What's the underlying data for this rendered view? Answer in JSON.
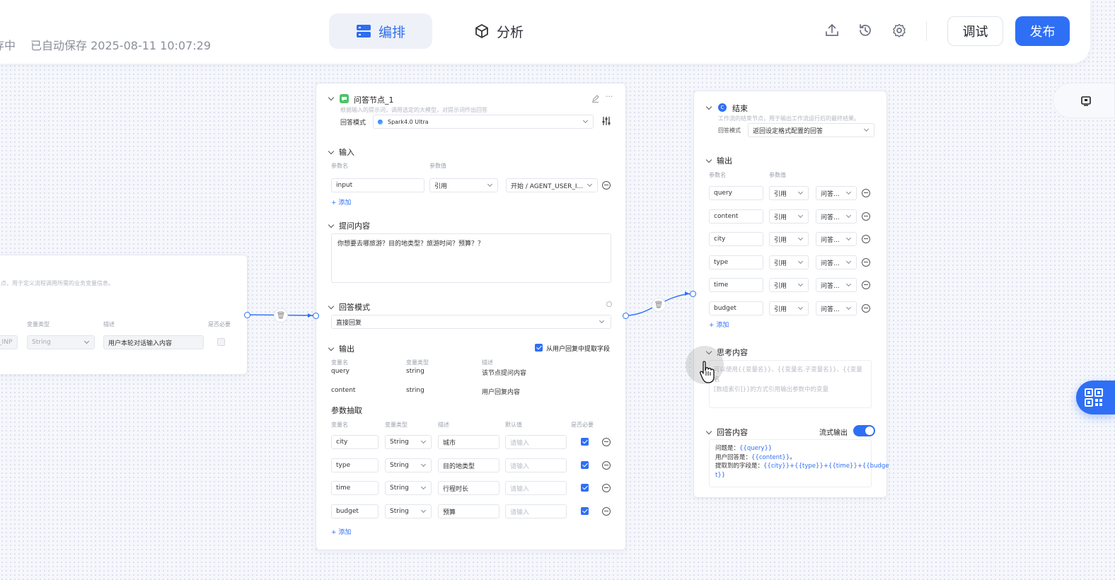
{
  "header": {
    "status_cut": "存中",
    "autosave": "已自动保存 2025-08-11 10:07:29",
    "tabs": [
      {
        "label": "编排"
      },
      {
        "label": "分析"
      }
    ],
    "debug_label": "调试",
    "publish_label": "发布",
    "accent": "#2f6ff5"
  },
  "start_node": {
    "desc": "点，用于定义流程调用所需的业务变量信息。",
    "col_type": "变量类型",
    "col_desc": "描述",
    "col_required": "是否必要",
    "var_name": "_INP",
    "type_value": "String",
    "desc_value": "用户本轮对话输入内容"
  },
  "qa_node": {
    "title": "问答节点_1",
    "desc": "根据输入的提示词，调用选定的大模型，对提示词作出回答",
    "model_label": "回答模式",
    "model_value": "Spark4.0 Ultra",
    "input_section": "输入",
    "col_param": "参数名",
    "col_value": "参数值",
    "input": {
      "name": "input",
      "mode": "引用",
      "ref": "开始 / AGENT_USER_I..."
    },
    "add": "添加",
    "question_section": "提问内容",
    "question": "你想要去哪旅游？目的地类型？旅游时间？预算？？",
    "answer_mode_section": "回答模式",
    "answer_mode_value": "直接回复",
    "output_section": "输出",
    "extract_label": "从用户回复中提取字段",
    "out_cols": [
      "变量名",
      "变量类型",
      "描述"
    ],
    "outputs": [
      {
        "name": "query",
        "type": "string",
        "desc": "该节点提问内容"
      },
      {
        "name": "content",
        "type": "string",
        "desc": "用户回复内容"
      }
    ],
    "extract_section": "参数抽取",
    "ex_cols": [
      "变量名",
      "变量类型",
      "描述",
      "默认值",
      "是否必要"
    ],
    "default_placeholder": "请输入",
    "extracts": [
      {
        "name": "city",
        "type": "String",
        "desc": "城市"
      },
      {
        "name": "type",
        "type": "String",
        "desc": "目的地类型"
      },
      {
        "name": "time",
        "type": "String",
        "desc": "行程时长"
      },
      {
        "name": "budget",
        "type": "String",
        "desc": "预算"
      }
    ]
  },
  "end_node": {
    "title": "结束",
    "desc": "工作流的结束节点，用于输出工作流运行后的最终结果。",
    "mode_label": "回答模式",
    "mode_value": "返回设定格式配置的回答",
    "output_section": "输出",
    "col_param": "参数名",
    "col_value": "参数值",
    "rows": [
      {
        "name": "query",
        "mode": "引用",
        "ref": "问答..."
      },
      {
        "name": "content",
        "mode": "引用",
        "ref": "问答..."
      },
      {
        "name": "city",
        "mode": "引用",
        "ref": "问答..."
      },
      {
        "name": "type",
        "mode": "引用",
        "ref": "问答..."
      },
      {
        "name": "time",
        "mode": "引用",
        "ref": "问答..."
      },
      {
        "name": "budget",
        "mode": "引用",
        "ref": "问答..."
      }
    ],
    "add": "添加",
    "think_section": "思考内容",
    "think_ph1": "可以使用{{变量名}}、{{变量名.子变量名}}、{{变量名",
    "think_ph2": "[数组索引]}}的方式引用输出参数中的变量",
    "answer_section": "回答内容",
    "stream_label": "流式输出",
    "answer": {
      "l1a": "问题是：",
      "l1b": "{{query}}",
      "l2a": "用户回答是：",
      "l2b": "{{content}}",
      "l2c": "。",
      "l3a": "提取到的字段是：",
      "l3b": "{{city}}+{{type}}+{{time}}+{{budge",
      "l4": "t}}"
    }
  }
}
